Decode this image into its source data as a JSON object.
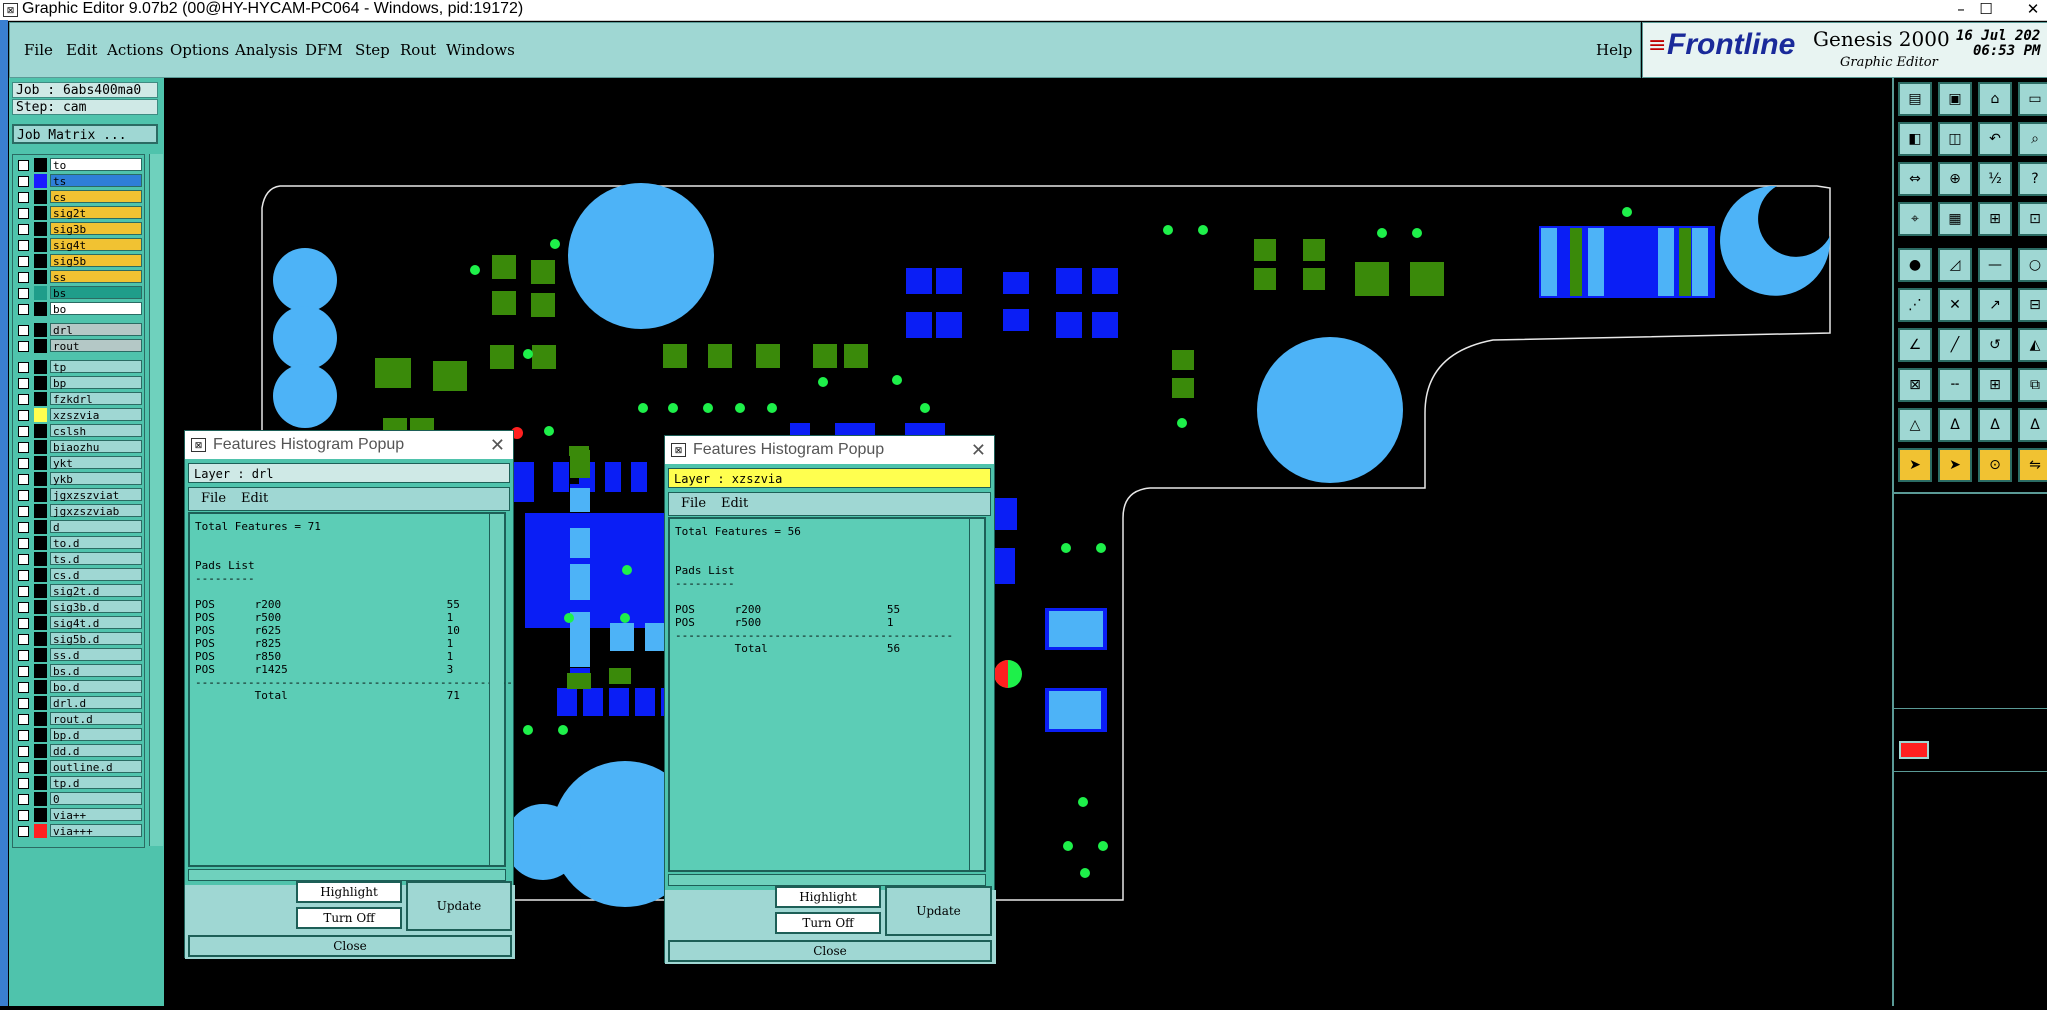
{
  "window": {
    "title": "Graphic Editor 9.07b2 (00@HY-HYCAM-PC064 - Windows, pid:19172)",
    "icon": "app-icon",
    "controls": [
      "–",
      "☐",
      "✕"
    ]
  },
  "menu": {
    "items": [
      "File",
      "Edit",
      "Actions",
      "Options",
      "Analysis",
      "DFM",
      "Step",
      "Rout",
      "Windows"
    ],
    "help": "Help"
  },
  "brand": {
    "logo": "Frontline",
    "product": "Genesis 2000",
    "subtitle": "Graphic Editor",
    "date": "16 Jul 202",
    "time": "06:53 PM"
  },
  "job": {
    "job_line": "Job : 6abs400ma0",
    "step_line": "Step: cam",
    "matrix_button": "Job Matrix ..."
  },
  "layers": [
    {
      "name": "to",
      "color": "#ffffff",
      "row": 0
    },
    {
      "name": "ts",
      "color": "#2f7fd8",
      "row": 1,
      "swatch": "#1a1aff"
    },
    {
      "name": "cs",
      "color": "#f1c232",
      "row": 2
    },
    {
      "name": "sig2t",
      "color": "#f1c232",
      "row": 3
    },
    {
      "name": "sig3b",
      "color": "#f1c232",
      "row": 4
    },
    {
      "name": "sig4t",
      "color": "#f1c232",
      "row": 5
    },
    {
      "name": "sig5b",
      "color": "#f1c232",
      "row": 6
    },
    {
      "name": "ss",
      "color": "#f1c232",
      "row": 7
    },
    {
      "name": "bs",
      "color": "#1f9d8a",
      "row": 8,
      "swatch": "#1f9d8a"
    },
    {
      "name": "bo",
      "color": "#ffffff",
      "row": 9
    },
    {
      "name": "drl",
      "color": "#b4c8c6",
      "row": 10.3
    },
    {
      "name": "rout",
      "color": "#b4c8c6",
      "row": 11.3
    },
    {
      "name": "tp",
      "color": "#9fd7d3",
      "row": 12.6
    },
    {
      "name": "bp",
      "color": "#9fd7d3",
      "row": 13.6
    },
    {
      "name": "fzkdrl",
      "color": "#9fd7d3",
      "row": 14.6
    },
    {
      "name": "xzszvia",
      "color": "#9fd7d3",
      "row": 15.6,
      "swatch": "#ffff4f"
    },
    {
      "name": "cslsh",
      "color": "#9fd7d3",
      "row": 16.6
    },
    {
      "name": "biaozhu",
      "color": "#9fd7d3",
      "row": 17.6
    },
    {
      "name": "ykt",
      "color": "#9fd7d3",
      "row": 18.6
    },
    {
      "name": "ykb",
      "color": "#9fd7d3",
      "row": 19.6
    },
    {
      "name": "jgxzszviat",
      "color": "#9fd7d3",
      "row": 20.6
    },
    {
      "name": "jgxzszviab",
      "color": "#9fd7d3",
      "row": 21.6
    },
    {
      "name": "d",
      "color": "#9fd7d3",
      "row": 22.6
    },
    {
      "name": "to.d",
      "color": "#9fd7d3",
      "row": 23.6
    },
    {
      "name": "ts.d",
      "color": "#9fd7d3",
      "row": 24.6
    },
    {
      "name": "cs.d",
      "color": "#9fd7d3",
      "row": 25.6
    },
    {
      "name": "sig2t.d",
      "color": "#9fd7d3",
      "row": 26.6
    },
    {
      "name": "sig3b.d",
      "color": "#9fd7d3",
      "row": 27.6
    },
    {
      "name": "sig4t.d",
      "color": "#9fd7d3",
      "row": 28.6
    },
    {
      "name": "sig5b.d",
      "color": "#9fd7d3",
      "row": 29.6
    },
    {
      "name": "ss.d",
      "color": "#9fd7d3",
      "row": 30.6
    },
    {
      "name": "bs.d",
      "color": "#9fd7d3",
      "row": 31.6
    },
    {
      "name": "bo.d",
      "color": "#9fd7d3",
      "row": 32.6
    },
    {
      "name": "drl.d",
      "color": "#9fd7d3",
      "row": 33.6
    },
    {
      "name": "rout.d",
      "color": "#9fd7d3",
      "row": 34.6
    },
    {
      "name": "bp.d",
      "color": "#9fd7d3",
      "row": 35.6
    },
    {
      "name": "dd.d",
      "color": "#9fd7d3",
      "row": 36.6
    },
    {
      "name": "outline.d",
      "color": "#9fd7d3",
      "row": 37.6
    },
    {
      "name": "tp.d",
      "color": "#9fd7d3",
      "row": 38.6
    },
    {
      "name": "0",
      "color": "#9fd7d3",
      "row": 39.6
    },
    {
      "name": "via++",
      "color": "#9fd7d3",
      "row": 40.6
    },
    {
      "name": "via+++",
      "color": "#9fd7d3",
      "row": 41.6,
      "swatch": "#ff2020"
    }
  ],
  "popup1": {
    "title": "Features Histogram Popup",
    "layer_line": "Layer :  drl",
    "menu": [
      "File",
      "Edit"
    ],
    "lines": [
      "Total Features = 71",
      "",
      "",
      "Pads List",
      "---------",
      "",
      "POS      r200                         55",
      "POS      r500                         1",
      "POS      r625                         10",
      "POS      r825                         1",
      "POS      r850                         1",
      "POS      r1425                        3",
      "------------------------------------------------",
      "         Total                        71"
    ],
    "buttons": {
      "highlight": "Highlight",
      "turn_off": "Turn Off",
      "update": "Update",
      "close": "Close"
    }
  },
  "popup2": {
    "title": "Features Histogram Popup",
    "layer_line": "Layer :  xzszvia",
    "menu": [
      "File",
      "Edit"
    ],
    "lines": [
      "Total Features = 56",
      "",
      "",
      "Pads List",
      "---------",
      "",
      "POS      r200                   55",
      "POS      r500                   1",
      "------------------------------------------",
      "         Total                  56"
    ],
    "buttons": {
      "highlight": "Highlight",
      "turn_off": "Turn Off",
      "update": "Update",
      "close": "Close"
    }
  },
  "colors": {
    "panel": "#4fc3ac",
    "light_panel": "#9fd7d3",
    "pad_light_blue": "#4db3f7",
    "pad_dark_blue": "#0a1ef5",
    "pad_green": "#3a8a0a",
    "drill_green": "#1ef04a",
    "outline": "#e8e8e8"
  },
  "toolbar_icons": [
    "open-step-icon",
    "save-icon",
    "home-icon",
    "window-icon",
    "zoom-window-icon",
    "zoom-step-icon",
    "zoom-back-icon",
    "zoom-icon",
    "fit-icon",
    "center-icon",
    "scale-1-2-icon",
    "query-icon",
    "measure-icon",
    "grid-icon",
    "snap-icon",
    "snap-pad-icon",
    "pad-icon",
    "draw-icon",
    "line-icon",
    "circle-icon",
    "connect-icon",
    "cut-icon",
    "move-icon",
    "net-icon",
    "arc-icon",
    "slant-icon",
    "curve-icon",
    "surface-icon",
    "pad-snap-icon",
    "dash-icon",
    "box-icon",
    "group-icon",
    "triangle-icon",
    "arrow-a-icon",
    "arrow-b-icon",
    "arrow-c-icon",
    "select-icon",
    "select-drag-icon",
    "select-circle-icon",
    "select-multi-icon"
  ]
}
